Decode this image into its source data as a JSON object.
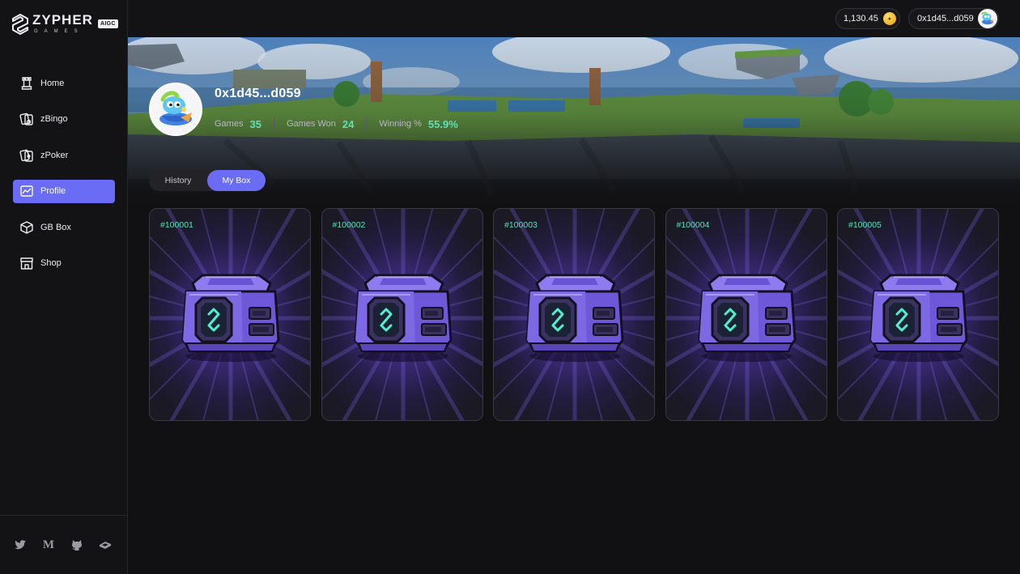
{
  "brand": {
    "name": "ZYPHER",
    "sub": "GAMES",
    "badge": "AIGC"
  },
  "sidebar": {
    "items": [
      {
        "label": "Home",
        "icon": "tower-icon",
        "active": false
      },
      {
        "label": "zBingo",
        "icon": "bingo-cards-icon",
        "active": false
      },
      {
        "label": "zPoker",
        "icon": "poker-cards-icon",
        "active": false
      },
      {
        "label": "Profile",
        "icon": "chart-icon",
        "active": true
      },
      {
        "label": "GB Box",
        "icon": "box-icon",
        "active": false
      },
      {
        "label": "Shop",
        "icon": "shop-icon",
        "active": false
      }
    ],
    "socials": [
      "twitter-icon",
      "medium-icon",
      "github-icon",
      "gitbook-icon"
    ],
    "medium_glyph": "M"
  },
  "topbar": {
    "balance": "1,130.45",
    "wallet": "0x1d45...d059"
  },
  "profile": {
    "name": "0x1d45...d059",
    "stats": [
      {
        "label": "Games",
        "value": "35"
      },
      {
        "label": "Games Won",
        "value": "24"
      },
      {
        "label": "Winning %",
        "value": "55.9%"
      }
    ]
  },
  "tabs": {
    "history": "History",
    "mybox": "My Box",
    "active": "mybox"
  },
  "boxes": [
    "#100001",
    "#100002",
    "#100003",
    "#100004",
    "#100005"
  ],
  "colors": {
    "accent": "#6a6cf5",
    "stat_value": "#5ee0b8",
    "box_id": "#5ee0b8",
    "background": "#111113"
  }
}
